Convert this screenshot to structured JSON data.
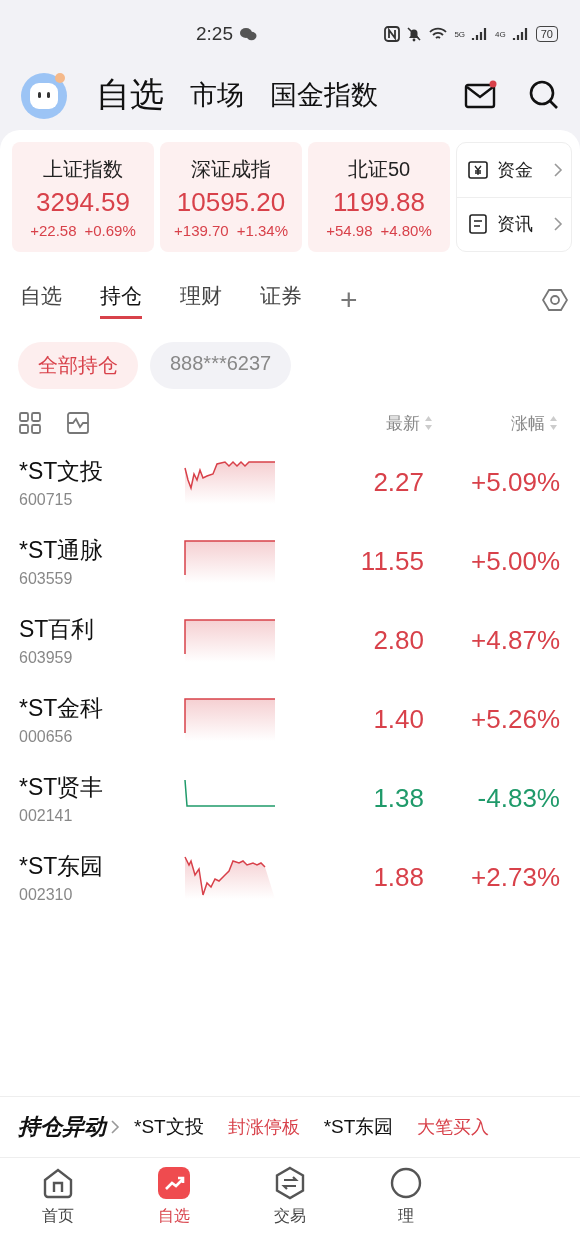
{
  "status_bar": {
    "time": "2:25",
    "network_labels": [
      "5G",
      "4G"
    ],
    "battery": "70"
  },
  "header": {
    "tabs": [
      {
        "label": "自选",
        "selected": true
      },
      {
        "label": "市场",
        "selected": false
      },
      {
        "label": "国金指数",
        "selected": false
      }
    ],
    "mail_unread": true
  },
  "indices": [
    {
      "name": "上证指数",
      "value": "3294.59",
      "change": "+22.58",
      "percent": "+0.69%",
      "color": "#d8414a"
    },
    {
      "name": "深证成指",
      "value": "10595.20",
      "change": "+139.70",
      "percent": "+1.34%",
      "color": "#d8414a"
    },
    {
      "name": "北证50",
      "value": "1199.88",
      "change": "+54.98",
      "percent": "+4.80%",
      "color": "#d8414a"
    }
  ],
  "quick_links": [
    {
      "label": "资金",
      "kind": "money"
    },
    {
      "label": "资讯",
      "kind": "news"
    }
  ],
  "sub_tabs": [
    {
      "label": "自选",
      "selected": false
    },
    {
      "label": "持仓",
      "selected": true
    },
    {
      "label": "理财",
      "selected": false
    },
    {
      "label": "证券",
      "selected": false
    }
  ],
  "add_tab": "+",
  "accounts": [
    {
      "label": "全部持仓",
      "selected": true
    },
    {
      "label": "888***6237",
      "selected": false
    }
  ],
  "columns": [
    "最新",
    "涨幅"
  ],
  "stocks": [
    {
      "name": "*ST文投",
      "code": "600715",
      "price": "2.27",
      "change": "+5.09%",
      "color": "#d8414a",
      "kind": "rise"
    },
    {
      "name": "*ST通脉",
      "code": "603559",
      "price": "11.55",
      "change": "+5.00%",
      "color": "#d8414a",
      "kind": "limit"
    },
    {
      "name": "ST百利",
      "code": "603959",
      "price": "2.80",
      "change": "+4.87%",
      "color": "#d8414a",
      "kind": "limit"
    },
    {
      "name": "*ST金科",
      "code": "000656",
      "price": "1.40",
      "change": "+5.26%",
      "color": "#d8414a",
      "kind": "limit"
    },
    {
      "name": "*ST贤丰",
      "code": "002141",
      "price": "1.38",
      "change": "-4.83%",
      "color": "#1f9a6a",
      "kind": "drop"
    },
    {
      "name": "*ST东园",
      "code": "002310",
      "price": "1.88",
      "change": "+2.73%",
      "color": "#d8414a",
      "kind": "dip"
    }
  ],
  "ticker": {
    "title": "持仓异动",
    "items": [
      {
        "name": "*ST文投",
        "event": "封涨停板"
      },
      {
        "name": "*ST东园",
        "event": "大笔买入"
      }
    ]
  },
  "bottom_nav": [
    {
      "label": "首页",
      "kind": "home",
      "selected": false
    },
    {
      "label": "自选",
      "kind": "watch",
      "selected": true
    },
    {
      "label": "交易",
      "kind": "trade",
      "selected": false
    },
    {
      "label": "理",
      "kind": "finance",
      "selected": false
    }
  ]
}
